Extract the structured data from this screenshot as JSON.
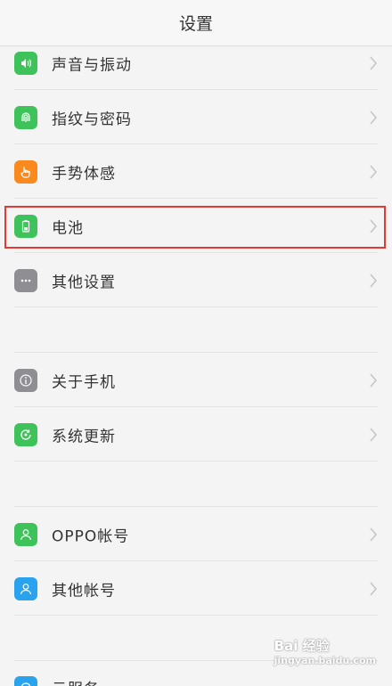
{
  "header": {
    "title": "设置"
  },
  "colors": {
    "green": "#3dc35a",
    "orange": "#fb8a1e",
    "gray": "#8e8e93",
    "blue": "#2aa3ef",
    "highlight": "#e53935"
  },
  "items": [
    {
      "label": "声音与振动",
      "icon": "speaker-icon",
      "color": "green"
    },
    {
      "label": "指纹与密码",
      "icon": "fingerprint-icon",
      "color": "green"
    },
    {
      "label": "手势体感",
      "icon": "hand-gesture-icon",
      "color": "orange"
    },
    {
      "label": "电池",
      "icon": "battery-icon",
      "color": "green",
      "highlighted": true
    },
    {
      "label": "其他设置",
      "icon": "more-dots-icon",
      "color": "gray"
    },
    {
      "label": "关于手机",
      "icon": "info-icon",
      "color": "gray"
    },
    {
      "label": "系统更新",
      "icon": "update-icon",
      "color": "green"
    },
    {
      "label": "OPPO帐号",
      "icon": "user-icon",
      "color": "green"
    },
    {
      "label": "其他帐号",
      "icon": "user-icon",
      "color": "blue"
    },
    {
      "label": "云服务",
      "icon": "cloud-icon",
      "color": "blue"
    }
  ],
  "watermark": {
    "text": "Bai 经验",
    "sub": "jingyan.baidu.com"
  }
}
